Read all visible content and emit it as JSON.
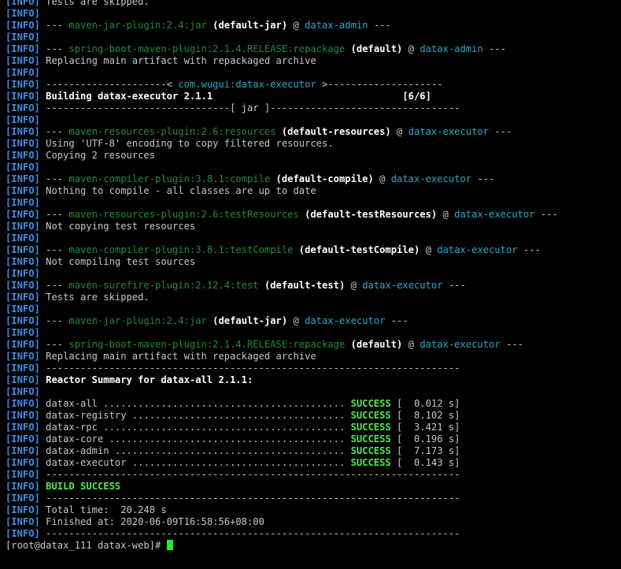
{
  "colors": {
    "background": "#000000",
    "text": "#c7c7c7",
    "level_tag": "#3b8eea",
    "bold": "#ffffff",
    "plugin": "#1e8c3a",
    "artifact": "#29a9c9",
    "success": "#4eea4e",
    "cursor": "#22ee22"
  },
  "terminal": {
    "lines": [
      [
        [
          "lvl",
          "[INFO]"
        ],
        [
          "plain",
          " Tests are skipped."
        ]
      ],
      [
        [
          "lvl",
          "[INFO]"
        ]
      ],
      [
        [
          "lvl",
          "[INFO]"
        ],
        [
          "plain",
          " --- "
        ],
        [
          "plugin",
          "maven-jar-plugin:2.4:jar"
        ],
        [
          "plain",
          " "
        ],
        [
          "bold",
          "(default-jar)"
        ],
        [
          "plain",
          " @ "
        ],
        [
          "artifact",
          "datax-admin"
        ],
        [
          "plain",
          " ---"
        ]
      ],
      [
        [
          "lvl",
          "[INFO]"
        ]
      ],
      [
        [
          "lvl",
          "[INFO]"
        ],
        [
          "plain",
          " --- "
        ],
        [
          "plugin",
          "spring-boot-maven-plugin:2.1.4.RELEASE:repackage"
        ],
        [
          "plain",
          " "
        ],
        [
          "bold",
          "(default)"
        ],
        [
          "plain",
          " @ "
        ],
        [
          "artifact",
          "datax-admin"
        ],
        [
          "plain",
          " ---"
        ]
      ],
      [
        [
          "lvl",
          "[INFO]"
        ],
        [
          "plain",
          " Replacing main artifact with repackaged archive"
        ]
      ],
      [
        [
          "lvl",
          "[INFO]"
        ]
      ],
      [
        [
          "lvl",
          "[INFO]"
        ],
        [
          "plain",
          " ---------------------< "
        ],
        [
          "artifact",
          "com.wugui:datax-executor"
        ],
        [
          "plain",
          " >--------------------"
        ]
      ],
      [
        [
          "lvl",
          "[INFO]"
        ],
        [
          "bold",
          " Building datax-executor 2.1.1                                 [6/6]"
        ]
      ],
      [
        [
          "lvl",
          "[INFO]"
        ],
        [
          "plain",
          " --------------------------------[ jar ]---------------------------------"
        ]
      ],
      [
        [
          "lvl",
          "[INFO]"
        ]
      ],
      [
        [
          "lvl",
          "[INFO]"
        ],
        [
          "plain",
          " --- "
        ],
        [
          "plugin",
          "maven-resources-plugin:2.6:resources"
        ],
        [
          "plain",
          " "
        ],
        [
          "bold",
          "(default-resources)"
        ],
        [
          "plain",
          " @ "
        ],
        [
          "artifact",
          "datax-executor"
        ],
        [
          "plain",
          " ---"
        ]
      ],
      [
        [
          "lvl",
          "[INFO]"
        ],
        [
          "plain",
          " Using 'UTF-8' encoding to copy filtered resources."
        ]
      ],
      [
        [
          "lvl",
          "[INFO]"
        ],
        [
          "plain",
          " Copying 2 resources"
        ]
      ],
      [
        [
          "lvl",
          "[INFO]"
        ]
      ],
      [
        [
          "lvl",
          "[INFO]"
        ],
        [
          "plain",
          " --- "
        ],
        [
          "plugin",
          "maven-compiler-plugin:3.8.1:compile"
        ],
        [
          "plain",
          " "
        ],
        [
          "bold",
          "(default-compile)"
        ],
        [
          "plain",
          " @ "
        ],
        [
          "artifact",
          "datax-executor"
        ],
        [
          "plain",
          " ---"
        ]
      ],
      [
        [
          "lvl",
          "[INFO]"
        ],
        [
          "plain",
          " Nothing to compile - all classes are up to date"
        ]
      ],
      [
        [
          "lvl",
          "[INFO]"
        ]
      ],
      [
        [
          "lvl",
          "[INFO]"
        ],
        [
          "plain",
          " --- "
        ],
        [
          "plugin",
          "maven-resources-plugin:2.6:testResources"
        ],
        [
          "plain",
          " "
        ],
        [
          "bold",
          "(default-testResources)"
        ],
        [
          "plain",
          " @ "
        ],
        [
          "artifact",
          "datax-executor"
        ],
        [
          "plain",
          " ---"
        ]
      ],
      [
        [
          "lvl",
          "[INFO]"
        ],
        [
          "plain",
          " Not copying test resources"
        ]
      ],
      [
        [
          "lvl",
          "[INFO]"
        ]
      ],
      [
        [
          "lvl",
          "[INFO]"
        ],
        [
          "plain",
          " --- "
        ],
        [
          "plugin",
          "maven-compiler-plugin:3.8.1:testCompile"
        ],
        [
          "plain",
          " "
        ],
        [
          "bold",
          "(default-testCompile)"
        ],
        [
          "plain",
          " @ "
        ],
        [
          "artifact",
          "datax-executor"
        ],
        [
          "plain",
          " ---"
        ]
      ],
      [
        [
          "lvl",
          "[INFO]"
        ],
        [
          "plain",
          " Not compiling test sources"
        ]
      ],
      [
        [
          "lvl",
          "[INFO]"
        ]
      ],
      [
        [
          "lvl",
          "[INFO]"
        ],
        [
          "plain",
          " --- "
        ],
        [
          "plugin",
          "maven-surefire-plugin:2.12.4:test"
        ],
        [
          "plain",
          " "
        ],
        [
          "bold",
          "(default-test)"
        ],
        [
          "plain",
          " @ "
        ],
        [
          "artifact",
          "datax-executor"
        ],
        [
          "plain",
          " ---"
        ]
      ],
      [
        [
          "lvl",
          "[INFO]"
        ],
        [
          "plain",
          " Tests are skipped."
        ]
      ],
      [
        [
          "lvl",
          "[INFO]"
        ]
      ],
      [
        [
          "lvl",
          "[INFO]"
        ],
        [
          "plain",
          " --- "
        ],
        [
          "plugin",
          "maven-jar-plugin:2.4:jar"
        ],
        [
          "plain",
          " "
        ],
        [
          "bold",
          "(default-jar)"
        ],
        [
          "plain",
          " @ "
        ],
        [
          "artifact",
          "datax-executor"
        ],
        [
          "plain",
          " ---"
        ]
      ],
      [
        [
          "lvl",
          "[INFO]"
        ]
      ],
      [
        [
          "lvl",
          "[INFO]"
        ],
        [
          "plain",
          " --- "
        ],
        [
          "plugin",
          "spring-boot-maven-plugin:2.1.4.RELEASE:repackage"
        ],
        [
          "plain",
          " "
        ],
        [
          "bold",
          "(default)"
        ],
        [
          "plain",
          " @ "
        ],
        [
          "artifact",
          "datax-executor"
        ],
        [
          "plain",
          " ---"
        ]
      ],
      [
        [
          "lvl",
          "[INFO]"
        ],
        [
          "plain",
          " Replacing main artifact with repackaged archive"
        ]
      ],
      [
        [
          "lvl",
          "[INFO]"
        ],
        [
          "plain",
          " ------------------------------------------------------------------------"
        ]
      ],
      [
        [
          "lvl",
          "[INFO]"
        ],
        [
          "bold",
          " Reactor Summary for datax-all 2.1.1:"
        ]
      ],
      [
        [
          "lvl",
          "[INFO]"
        ]
      ],
      [
        [
          "lvl",
          "[INFO]"
        ],
        [
          "plain",
          " datax-all .......................................... "
        ],
        [
          "ok",
          "SUCCESS"
        ],
        [
          "plain",
          " [  0.012 s]"
        ]
      ],
      [
        [
          "lvl",
          "[INFO]"
        ],
        [
          "plain",
          " datax-registry ..................................... "
        ],
        [
          "ok",
          "SUCCESS"
        ],
        [
          "plain",
          " [  8.102 s]"
        ]
      ],
      [
        [
          "lvl",
          "[INFO]"
        ],
        [
          "plain",
          " datax-rpc .......................................... "
        ],
        [
          "ok",
          "SUCCESS"
        ],
        [
          "plain",
          " [  3.421 s]"
        ]
      ],
      [
        [
          "lvl",
          "[INFO]"
        ],
        [
          "plain",
          " datax-core ......................................... "
        ],
        [
          "ok",
          "SUCCESS"
        ],
        [
          "plain",
          " [  0.196 s]"
        ]
      ],
      [
        [
          "lvl",
          "[INFO]"
        ],
        [
          "plain",
          " datax-admin ........................................ "
        ],
        [
          "ok",
          "SUCCESS"
        ],
        [
          "plain",
          " [  7.173 s]"
        ]
      ],
      [
        [
          "lvl",
          "[INFO]"
        ],
        [
          "plain",
          " datax-executor ..................................... "
        ],
        [
          "ok",
          "SUCCESS"
        ],
        [
          "plain",
          " [  0.143 s]"
        ]
      ],
      [
        [
          "lvl",
          "[INFO]"
        ],
        [
          "plain",
          " ------------------------------------------------------------------------"
        ]
      ],
      [
        [
          "lvl",
          "[INFO]"
        ],
        [
          "plain",
          " "
        ],
        [
          "ok",
          "BUILD SUCCESS"
        ]
      ],
      [
        [
          "lvl",
          "[INFO]"
        ],
        [
          "plain",
          " ------------------------------------------------------------------------"
        ]
      ],
      [
        [
          "lvl",
          "[INFO]"
        ],
        [
          "plain",
          " Total time:  20.248 s"
        ]
      ],
      [
        [
          "lvl",
          "[INFO]"
        ],
        [
          "plain",
          " Finished at: 2020-06-09T16:58:56+08:00"
        ]
      ],
      [
        [
          "lvl",
          "[INFO]"
        ],
        [
          "plain",
          " ------------------------------------------------------------------------"
        ]
      ]
    ],
    "prompt": "[root@datax_111 datax-web]# "
  }
}
